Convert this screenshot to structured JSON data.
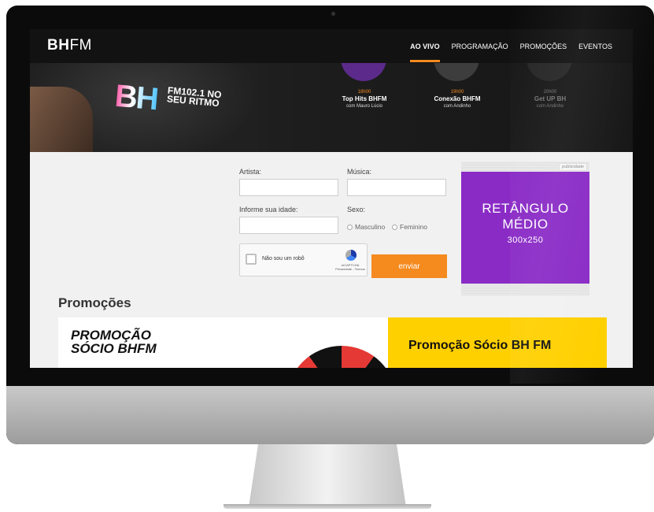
{
  "nav": {
    "logo_bold": "BH",
    "logo_light": "FM",
    "items": [
      "AO VIVO",
      "PROGRAMAÇÃO",
      "PROMOÇÕES",
      "EVENTOS"
    ]
  },
  "hero": {
    "shirt_logo": "BH",
    "shirt_tag": "FM102.1 NO SEU RITMO",
    "shows": [
      {
        "time": "18h00",
        "name": "Top Hits BHFM",
        "host": "com Mauro Lúcio"
      },
      {
        "time": "19h00",
        "name": "Conexão BHFM",
        "host": "com Andinho"
      },
      {
        "time": "20h00",
        "name": "Get UP BH",
        "host": "com Andinho"
      }
    ]
  },
  "form": {
    "artist_label": "Artista:",
    "song_label": "Música:",
    "age_label": "Informe sua idade:",
    "sex_label": "Sexo:",
    "male_label": "Masculino",
    "female_label": "Feminino",
    "captcha_text": "Não sou um robô",
    "captcha_brand": "reCAPTCHA",
    "captcha_links": "Privacidade - Termos",
    "submit_label": "enviar"
  },
  "ad": {
    "tag": "publicidade",
    "line1": "RETÂNGULO",
    "line2": "MÉDIO",
    "size": "300x250"
  },
  "promotions": {
    "title": "Promoções",
    "banner_left_1": "PROMOÇÃO",
    "banner_left_2": "SÓCIO BHFM",
    "banner_right": "Promoção Sócio BH FM"
  },
  "colors": {
    "accent": "#f58a1f",
    "ad_purple": "#8a2bc6",
    "banner_yellow": "#ffd000"
  }
}
